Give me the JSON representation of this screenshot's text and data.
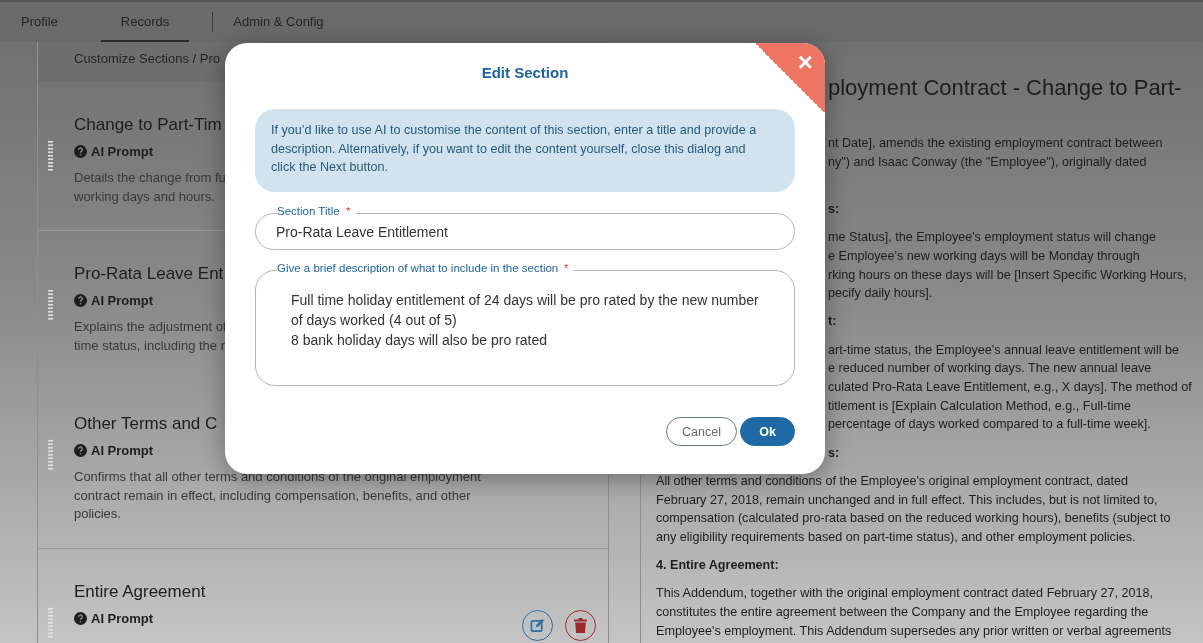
{
  "tabs": [
    {
      "label": "Profile",
      "selected": false
    },
    {
      "label": "Records",
      "selected": true
    },
    {
      "label": "Admin & Config",
      "selected": false
    }
  ],
  "breadcrumb": "Customize Sections / Pro",
  "sections": [
    {
      "title": "Change to Part-Tim",
      "prompt_label": "AI Prompt",
      "description": [
        "Details the change from fu",
        "working days and hours."
      ]
    },
    {
      "title": "Pro-Rata Leave Ent",
      "prompt_label": "AI Prompt",
      "description": [
        "Explains the adjustment of",
        "time status, including the r"
      ]
    },
    {
      "title": "Other Terms and C",
      "prompt_label": "AI Prompt",
      "description": [
        "Confirms that all other terms and conditions of the original employment",
        "contract remain in effect, including compensation, benefits, and other",
        "policies."
      ]
    },
    {
      "title": "Entire Agreement",
      "prompt_label": "AI Prompt",
      "show_actions": true
    }
  ],
  "document": {
    "title": "ployment Contract - Change to Part-",
    "paragraphs": [
      {
        "kind": "fragment-text",
        "lines": [
          "nt Date], amends the existing employment contract between",
          "ny\") and Isaac Conway (the \"Employee\"), originally dated"
        ]
      },
      {
        "kind": "fragment-heading",
        "lines": [
          "s:"
        ]
      },
      {
        "kind": "fragment-text",
        "lines": [
          "me Status], the Employee's employment status will change",
          "e Employee's new working days will be Monday through",
          "rking hours on these days will be [Insert Specific Working Hours,",
          "pecify daily hours]."
        ]
      },
      {
        "kind": "fragment-heading",
        "lines": [
          "t:"
        ]
      },
      {
        "kind": "fragment-text",
        "lines": [
          "art-time status, the Employee's annual leave entitlement will be",
          "e reduced number of working days. The new annual leave",
          "culated Pro-Rata Leave Entitlement, e.g., X days]. The method of",
          "titlement is [Explain Calculation Method, e.g., Full-time",
          "percentage of days worked compared to a full-time week]."
        ]
      },
      {
        "kind": "fragment-heading",
        "lines": [
          "s:"
        ]
      },
      {
        "kind": "text",
        "lines": [
          "All other terms and conditions of the Employee's original employment contract, dated",
          "February 27, 2018, remain unchanged and in full effect. This includes, but is not limited to,",
          "compensation (calculated pro-rata based on the reduced working hours), benefits (subject to",
          "any eligibility requirements based on part-time status), and other employment policies."
        ]
      },
      {
        "kind": "heading",
        "lines": [
          "4. Entire Agreement:"
        ]
      },
      {
        "kind": "text",
        "lines": [
          "This Addendum, together with the original employment contract dated February 27, 2018,",
          "constitutes the entire agreement between the Company and the Employee regarding the",
          "Employee's employment. This Addendum supersedes any prior written or verbal agreements"
        ]
      }
    ]
  },
  "dialog": {
    "title": "Edit Section",
    "close": "×",
    "info": "If you’d like to use AI to customise the content of this section, enter a title and provide a description. Alternatively, if you want to edit the content yourself, close this dialog and click the Next button.",
    "fields": [
      {
        "label": "Section Title",
        "required_mark": "*",
        "kind": "line",
        "value": "Pro-Rata Leave Entitlement"
      },
      {
        "label": "Give a brief description of what to include in the section",
        "required_mark": "*",
        "kind": "area",
        "value": "Full time holiday entitlement of 24 days will be pro rated by the new number of days worked (4 out of 5)\n8 bank holiday days will also be pro rated"
      }
    ],
    "buttons": [
      {
        "label": "Cancel",
        "kind": "secondary"
      },
      {
        "label": "Ok",
        "kind": "primary"
      }
    ]
  }
}
